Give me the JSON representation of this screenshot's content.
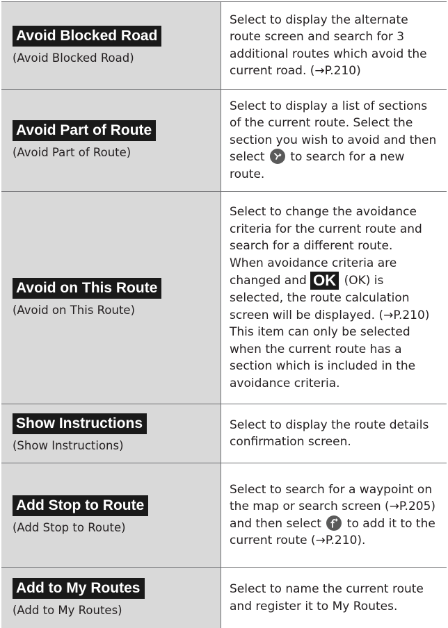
{
  "rows": [
    {
      "button": "Avoid Blocked Road",
      "sub": "(Avoid Blocked Road)",
      "description": "Select to display the alternate route screen and search for 3 additional routes which avoid the current road. (→P.210)"
    },
    {
      "button": "Avoid Part of Route",
      "sub": "(Avoid Part of Route)",
      "description_before_icon": "Select to display a list of sections of the current route. Select the section you wish to avoid and then select",
      "description_after_icon": "to search for a new route.",
      "icon": "detour-search-icon"
    },
    {
      "button": "Avoid on This Route",
      "sub": "(Avoid on This Route)",
      "description_part1": "Select to change the avoidance criteria for the current route and search for a different route.",
      "description_part2_before_ok": "When avoidance criteria are changed and",
      "ok_badge": "OK",
      "description_part2_after_ok": "(OK) is selected, the route calculation screen will be displayed. (→P.210)",
      "description_part3": "This item can only be selected when the current route has a section which is included in the avoidance criteria."
    },
    {
      "button": "Show Instructions",
      "sub": "(Show Instructions)",
      "description": "Select to display the route details confirmation screen."
    },
    {
      "button": "Add Stop to Route",
      "sub": "(Add Stop to Route)",
      "description_before_icon": "Select to search for a waypoint on the map or search screen (→P.205) and then select",
      "description_after_icon": "to add it to the current route (→P.210).",
      "icon": "add-waypoint-icon"
    },
    {
      "button": "Add to My Routes",
      "sub": "(Add to My Routes)",
      "description": "Select to name the current route and register it to My Routes."
    }
  ]
}
